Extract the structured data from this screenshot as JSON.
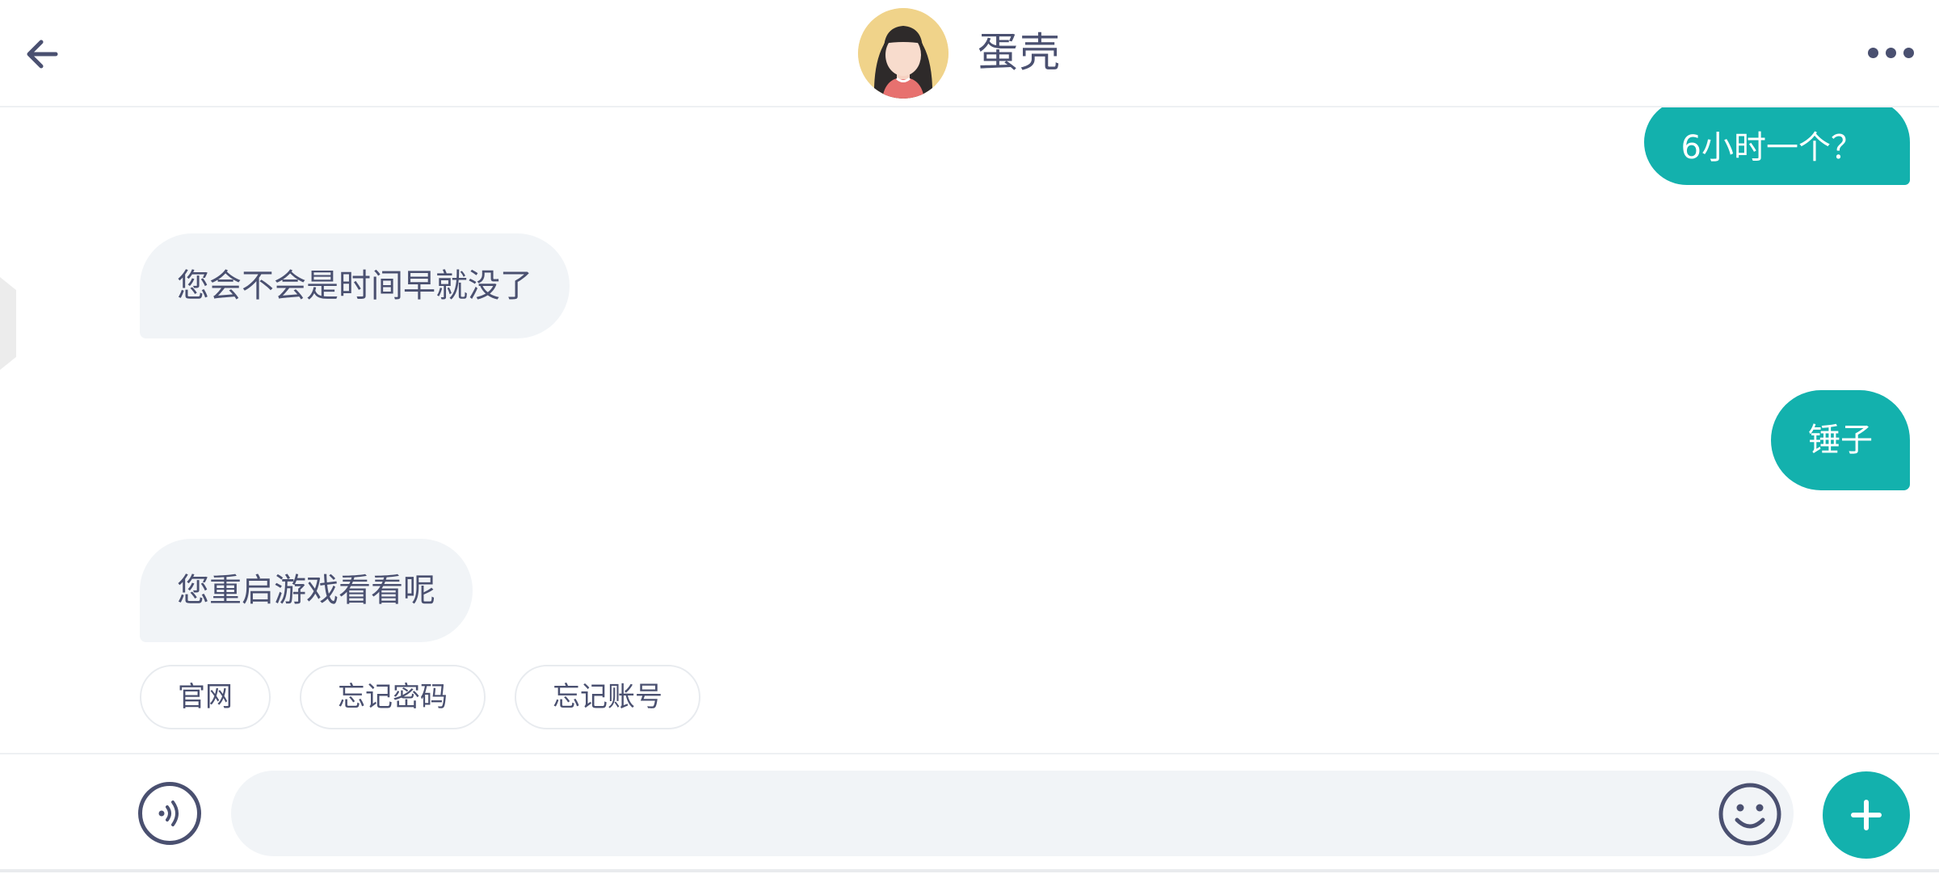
{
  "header": {
    "contact_name": "蛋壳",
    "back_icon": "arrow-left-icon",
    "more_icon": "more-horizontal-icon"
  },
  "messages": [
    {
      "direction": "outgoing",
      "text": "6小时一个？"
    },
    {
      "direction": "incoming",
      "text": "您会不会是时间早就没了"
    },
    {
      "direction": "outgoing",
      "text": "锤子"
    },
    {
      "direction": "incoming",
      "text": "您重启游戏看看呢"
    }
  ],
  "quick_replies": [
    "官网",
    "忘记密码",
    "忘记账号"
  ],
  "input_bar": {
    "placeholder": "",
    "voice_icon": "voice-icon",
    "emoji_icon": "emoji-icon",
    "plus_icon": "plus-icon"
  },
  "colors": {
    "accent": "#13b1ad",
    "text": "#4a5070",
    "incoming_bubble": "#f1f4f7"
  }
}
